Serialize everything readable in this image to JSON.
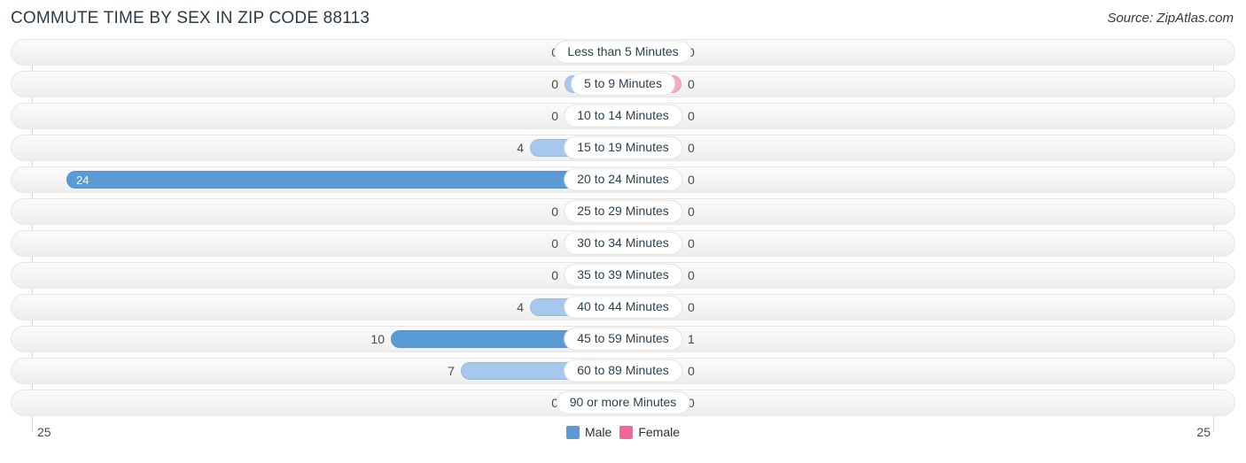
{
  "header": {
    "title": "COMMUTE TIME BY SEX IN ZIP CODE 88113",
    "source": "Source: ZipAtlas.com"
  },
  "legend": {
    "male_label": "Male",
    "female_label": "Female",
    "male_color": "#5b9bd5",
    "female_color": "#f4669a"
  },
  "axis": {
    "left_value": "25",
    "right_value": "25",
    "max": 25
  },
  "colors": {
    "male_light": "#a6c8ec",
    "male_strong": "#5b9bd5",
    "female_light": "#f9a8c4",
    "female_strong": "#f4669a",
    "track_border": "#e6e6e6",
    "title": "#2b3a4a"
  },
  "chart_data": {
    "type": "bar",
    "title": "COMMUTE TIME BY SEX IN ZIP CODE 88113",
    "subtitle": "",
    "xlabel": "",
    "ylabel": "",
    "orientation": "horizontal-diverging",
    "legend_position": "bottom-center",
    "grid": false,
    "xlim": [
      0,
      25
    ],
    "categories": [
      "Less than 5 Minutes",
      "5 to 9 Minutes",
      "10 to 14 Minutes",
      "15 to 19 Minutes",
      "20 to 24 Minutes",
      "25 to 29 Minutes",
      "30 to 34 Minutes",
      "35 to 39 Minutes",
      "40 to 44 Minutes",
      "45 to 59 Minutes",
      "60 to 89 Minutes",
      "90 or more Minutes"
    ],
    "series": [
      {
        "name": "Male",
        "values": [
          0,
          0,
          0,
          4,
          24,
          0,
          0,
          0,
          4,
          10,
          7,
          0
        ]
      },
      {
        "name": "Female",
        "values": [
          0,
          0,
          0,
          0,
          0,
          0,
          0,
          0,
          0,
          1,
          0,
          0
        ]
      }
    ]
  },
  "rows": [
    {
      "label": "Less than 5 Minutes",
      "male": "0",
      "female": "0"
    },
    {
      "label": "5 to 9 Minutes",
      "male": "0",
      "female": "0"
    },
    {
      "label": "10 to 14 Minutes",
      "male": "0",
      "female": "0"
    },
    {
      "label": "15 to 19 Minutes",
      "male": "4",
      "female": "0"
    },
    {
      "label": "20 to 24 Minutes",
      "male": "24",
      "female": "0"
    },
    {
      "label": "25 to 29 Minutes",
      "male": "0",
      "female": "0"
    },
    {
      "label": "30 to 34 Minutes",
      "male": "0",
      "female": "0"
    },
    {
      "label": "35 to 39 Minutes",
      "male": "0",
      "female": "0"
    },
    {
      "label": "40 to 44 Minutes",
      "male": "4",
      "female": "0"
    },
    {
      "label": "45 to 59 Minutes",
      "male": "10",
      "female": "1"
    },
    {
      "label": "60 to 89 Minutes",
      "male": "7",
      "female": "0"
    },
    {
      "label": "90 or more Minutes",
      "male": "0",
      "female": "0"
    }
  ]
}
